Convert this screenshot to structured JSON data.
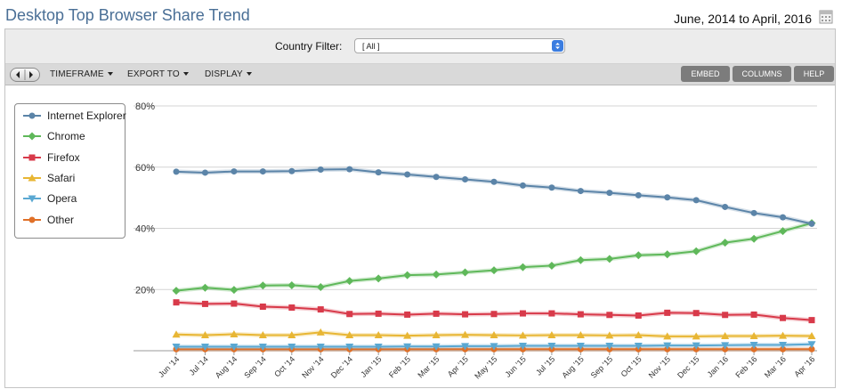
{
  "header": {
    "title": "Desktop Top Browser Share Trend",
    "date_range": "June, 2014 to April, 2016",
    "calendar_icon": "calendar-icon"
  },
  "filter": {
    "label": "Country Filter:",
    "value": "[ All ]"
  },
  "toolbar": {
    "timeframe": "TIMEFRAME",
    "export": "EXPORT TO",
    "display": "DISPLAY",
    "embed": "EMBED",
    "columns": "COLUMNS",
    "help": "HELP"
  },
  "chart_data": {
    "type": "line",
    "title": "",
    "xlabel": "",
    "ylabel": "",
    "ylim": [
      0,
      80
    ],
    "yticks": [
      "80%",
      "60%",
      "40%",
      "20%"
    ],
    "grid": true,
    "legend_position": "top-left",
    "categories": [
      "Jun '14",
      "Jul '14",
      "Aug '14",
      "Sep '14",
      "Oct '14",
      "Nov '14",
      "Dec '14",
      "Jan '15",
      "Feb '15",
      "Mar '15",
      "Apr '15",
      "May '15",
      "Jun '15",
      "Jul '15",
      "Aug '15",
      "Sep '15",
      "Oct '15",
      "Nov '15",
      "Dec '15",
      "Jan '16",
      "Feb '16",
      "Mar '16",
      "Apr '16"
    ],
    "series": [
      {
        "name": "Internet Explorer",
        "color": "#5b84a8",
        "marker": "circle",
        "values": [
          58.5,
          58.2,
          58.6,
          58.6,
          58.7,
          59.2,
          59.3,
          58.3,
          57.6,
          56.8,
          56.0,
          55.2,
          54.0,
          53.3,
          52.2,
          51.6,
          50.8,
          50.1,
          49.2,
          47.0,
          45.0,
          43.6,
          41.5
        ]
      },
      {
        "name": "Chrome",
        "color": "#5fb85a",
        "marker": "diamond",
        "values": [
          19.6,
          20.6,
          19.9,
          21.3,
          21.4,
          20.8,
          22.8,
          23.6,
          24.7,
          24.9,
          25.6,
          26.3,
          27.3,
          27.8,
          29.6,
          30.0,
          31.2,
          31.5,
          32.5,
          35.3,
          36.6,
          39.1,
          41.7
        ]
      },
      {
        "name": "Firefox",
        "color": "#d83a4a",
        "marker": "square",
        "values": [
          15.8,
          15.3,
          15.4,
          14.4,
          14.1,
          13.5,
          12.0,
          12.1,
          11.8,
          12.1,
          11.9,
          12.0,
          12.2,
          12.2,
          11.9,
          11.7,
          11.5,
          12.4,
          12.3,
          11.7,
          11.8,
          10.7,
          10.0
        ]
      },
      {
        "name": "Safari",
        "color": "#e8b634",
        "marker": "triangle-up",
        "values": [
          5.3,
          5.1,
          5.4,
          5.1,
          5.1,
          6.0,
          5.1,
          5.1,
          4.9,
          5.1,
          5.2,
          5.1,
          5.0,
          5.1,
          5.1,
          5.0,
          5.1,
          4.7,
          4.7,
          4.8,
          4.8,
          4.9,
          4.8
        ]
      },
      {
        "name": "Opera",
        "color": "#5aa8d2",
        "marker": "triangle-down",
        "values": [
          1.3,
          1.3,
          1.3,
          1.3,
          1.3,
          1.3,
          1.3,
          1.3,
          1.4,
          1.4,
          1.5,
          1.5,
          1.6,
          1.6,
          1.6,
          1.6,
          1.6,
          1.7,
          1.7,
          1.8,
          1.9,
          1.9,
          2.1
        ]
      },
      {
        "name": "Other",
        "color": "#e07028",
        "marker": "circle",
        "values": [
          0.5,
          0.5,
          0.5,
          0.5,
          0.5,
          0.5,
          0.5,
          0.5,
          0.5,
          0.5,
          0.5,
          0.5,
          0.5,
          0.5,
          0.5,
          0.5,
          0.5,
          0.5,
          0.5,
          0.5,
          0.5,
          0.5,
          0.5
        ]
      }
    ]
  }
}
